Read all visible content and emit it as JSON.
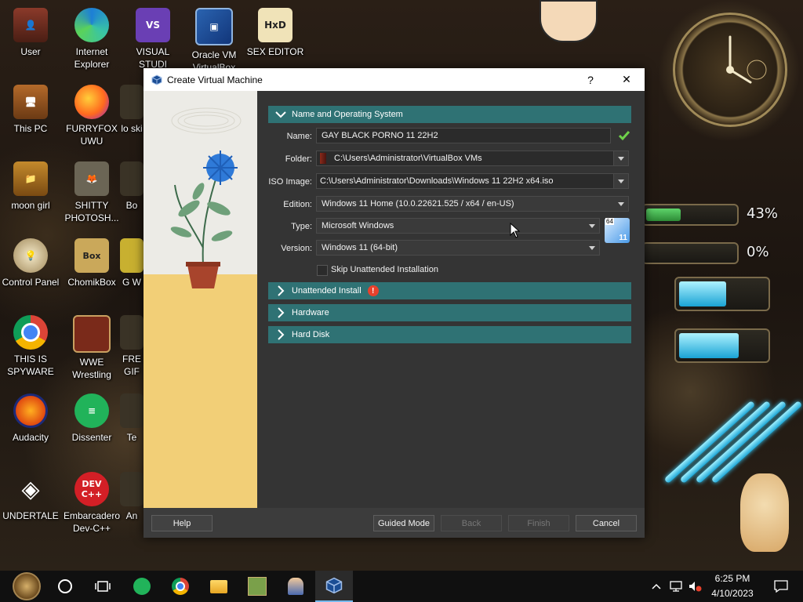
{
  "desktop": {
    "icons": [
      {
        "label": "User",
        "icon": "user-folder-icon"
      },
      {
        "label": "Internet Explorer",
        "icon": "edge-icon"
      },
      {
        "label": "VISUAL STUDI",
        "icon": "visual-studio-icon"
      },
      {
        "label": "Oracle VM VirtualBox",
        "icon": "virtualbox-icon"
      },
      {
        "label": "SEX EDITOR",
        "icon": "hxd-icon"
      },
      {
        "label": "This PC",
        "icon": "computer-icon"
      },
      {
        "label": "FURRYFOX UWU",
        "icon": "firefox-icon"
      },
      {
        "label": "lo ski",
        "icon": "app-icon"
      },
      {
        "label": "moon girl",
        "icon": "folder-icon"
      },
      {
        "label": "SHITTY PHOTOSH...",
        "icon": "gimp-icon"
      },
      {
        "label": "Bo",
        "icon": "app-icon"
      },
      {
        "label": "Control Panel",
        "icon": "control-panel-icon"
      },
      {
        "label": "ChomikBox",
        "icon": "chomikbox-icon"
      },
      {
        "label": "G W",
        "icon": "app-icon"
      },
      {
        "label": "THIS IS SPYWARE",
        "icon": "chrome-icon"
      },
      {
        "label": "WWE Wrestling",
        "icon": "wrestling-icon"
      },
      {
        "label": "FRE GIF",
        "icon": "app-icon"
      },
      {
        "label": "Audacity",
        "icon": "audacity-icon"
      },
      {
        "label": "Dissenter",
        "icon": "dissenter-icon"
      },
      {
        "label": "Te",
        "icon": "app-icon"
      },
      {
        "label": "UNDERTALE",
        "icon": "unity-icon"
      },
      {
        "label": "Embarcadero Dev-C++",
        "icon": "devcpp-icon"
      },
      {
        "label": "An",
        "icon": "app-icon"
      }
    ],
    "gauges": [
      {
        "percent_label": "43%",
        "level": 0.43,
        "color": "#3fb04a"
      },
      {
        "percent_label": "0%",
        "level": 0.0,
        "color": "#3fb04a"
      }
    ]
  },
  "dialog": {
    "title": "Create Virtual Machine",
    "help_symbol": "?",
    "close_symbol": "✕",
    "sections": [
      {
        "label": "Name and Operating System",
        "expanded": true
      },
      {
        "label": "Unattended Install",
        "expanded": false,
        "warning": true
      },
      {
        "label": "Hardware",
        "expanded": false
      },
      {
        "label": "Hard Disk",
        "expanded": false
      }
    ],
    "fields": {
      "name": {
        "label": "Name:",
        "value": "GAY BLACK PORNO 11 22H2"
      },
      "folder": {
        "label": "Folder:",
        "value": "C:\\Users\\Administrator\\VirtualBox VMs"
      },
      "iso": {
        "label": "ISO Image:",
        "value": "C:\\Users\\Administrator\\Downloads\\Windows 11 22H2 x64.iso"
      },
      "edition": {
        "label": "Edition:",
        "value": "Windows 11 Home (10.0.22621.525 / x64 / en-US)"
      },
      "type": {
        "label": "Type:",
        "value": "Microsoft Windows"
      },
      "version": {
        "label": "Version:",
        "value": "Windows 11 (64-bit)"
      },
      "skip": {
        "label": "Skip Unattended Installation",
        "checked": false
      }
    },
    "os_badge": {
      "bits": "64",
      "version": "11"
    },
    "buttons": {
      "help": "Help",
      "guided": "Guided Mode",
      "back": "Back",
      "finish": "Finish",
      "cancel": "Cancel"
    },
    "colors": {
      "accent": "#2f7274",
      "ok_check": "#6ed14a",
      "warning": "#e8412c"
    }
  },
  "taskbar": {
    "time": "6:25 PM",
    "date": "4/10/2023",
    "active_colors": {
      "underline": "#76b9ed"
    }
  }
}
